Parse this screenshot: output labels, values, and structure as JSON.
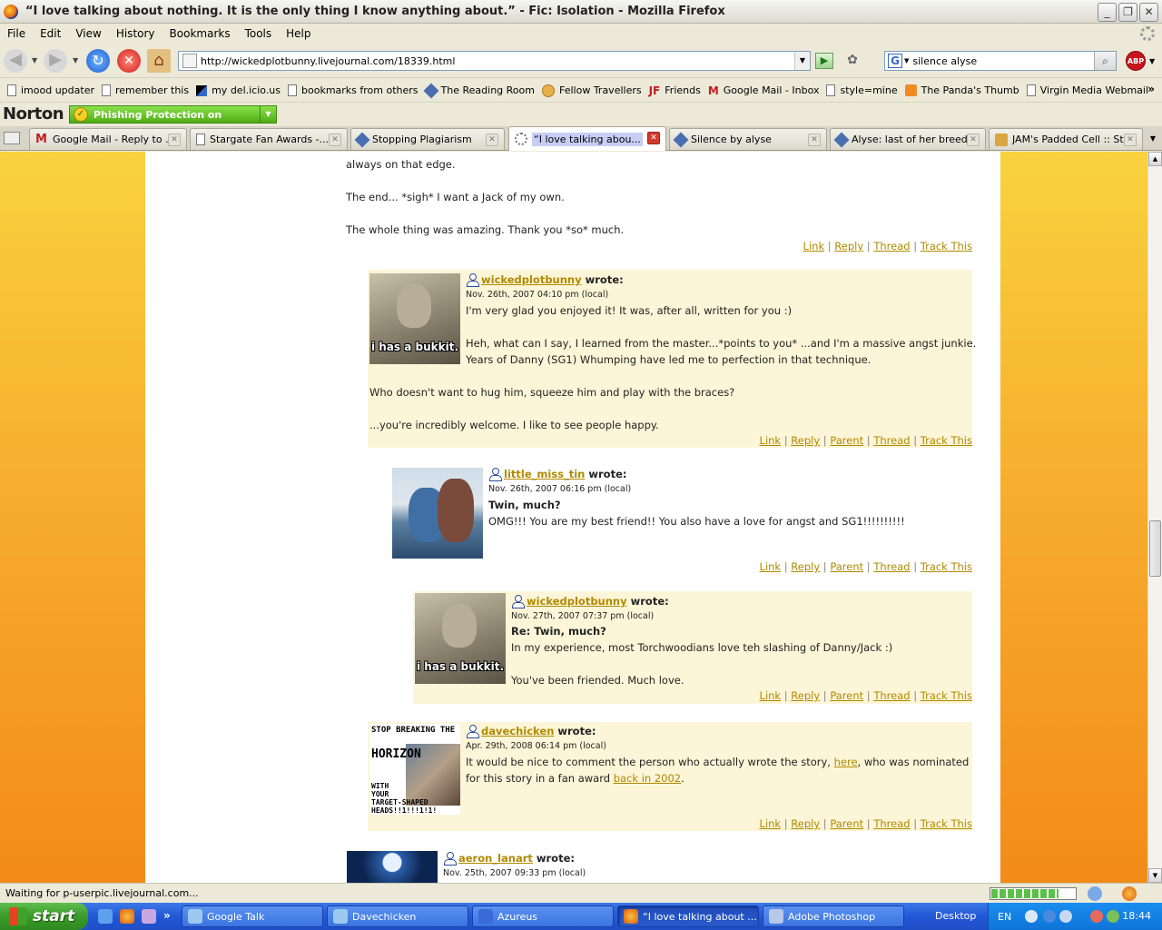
{
  "window": {
    "title": "“I love talking about nothing. It is the only thing I know anything about.” - Fic: Isolation - Mozilla Firefox",
    "controls": {
      "minimize": "_",
      "maximize": "❐",
      "close": "✕"
    }
  },
  "menu": [
    "File",
    "Edit",
    "View",
    "History",
    "Bookmarks",
    "Tools",
    "Help"
  ],
  "nav": {
    "url": "http://wickedplotbunny.livejournal.com/18339.html",
    "search_value": "silence alyse",
    "search_engine_icon": "G",
    "adblock_label": "ABP"
  },
  "bookmarks": [
    {
      "label": "imood updater",
      "icon": "page-icon"
    },
    {
      "label": "remember this",
      "icon": "page-icon"
    },
    {
      "label": "my del.icio.us",
      "icon": "delicious-icon"
    },
    {
      "label": "bookmarks from others",
      "icon": "page-icon"
    },
    {
      "label": "The Reading Room",
      "icon": "pen-icon"
    },
    {
      "label": "Fellow Travellers",
      "icon": "face-icon"
    },
    {
      "label": "Friends",
      "icon": "jf-icon"
    },
    {
      "label": "Google Mail - Inbox",
      "icon": "gmail-icon"
    },
    {
      "label": "style=mine",
      "icon": "page-icon"
    },
    {
      "label": "The Panda's Thumb",
      "icon": "rss-icon"
    },
    {
      "label": "Virgin Media Webmail",
      "icon": "page-icon"
    }
  ],
  "norton": {
    "logo": "Norton",
    "status": "Phishing Protection on"
  },
  "tabs": [
    {
      "label": "Google Mail - Reply to ...",
      "icon": "gmail-icon"
    },
    {
      "label": "Stargate Fan Awards -...",
      "icon": "page-icon"
    },
    {
      "label": "Stopping Plagiarism",
      "icon": "pen-icon"
    },
    {
      "label": "“I love talking abou...",
      "icon": "loading-icon",
      "active": true
    },
    {
      "label": "Silence by alyse",
      "icon": "pen-icon"
    },
    {
      "label": "Alyse: last of her breed",
      "icon": "pen-icon"
    },
    {
      "label": "JAM's Padded Cell :: St...",
      "icon": "cell-icon"
    }
  ],
  "page": {
    "top_lines": [
      "always on that edge.",
      "The end... *sigh* I want a Jack of my own.",
      "The whole thing was amazing. Thank you *so* much."
    ],
    "top_actions": [
      "Link",
      "Reply",
      "Thread",
      "Track This"
    ],
    "comments": [
      {
        "user": "wickedplotbunny",
        "wrote": "wrote:",
        "date": "Nov. 26th, 2007 04:10 pm (local)",
        "userpic_caption": "i has a bukkit.",
        "lines": [
          "I'm very glad you enjoyed it! It was, after all, written for you :)",
          "Heh, what can I say, I learned from the master...*points to you* ...and I'm a massive angst junkie.",
          "Years of Danny (SG1) Whumping have led me to perfection in that technique.",
          "Who doesn't want to hug him, squeeze him and play with the braces?",
          "...you're incredibly welcome. I like to see people happy."
        ],
        "actions": [
          "Link",
          "Reply",
          "Parent",
          "Thread",
          "Track This"
        ]
      },
      {
        "user": "little_miss_tin",
        "wrote": "wrote:",
        "date": "Nov. 26th, 2007 06:16 pm (local)",
        "subject": "Twin, much?",
        "lines": [
          "OMG!!! You are my best friend!! You also have a love for angst and SG1!!!!!!!!!!"
        ],
        "actions": [
          "Link",
          "Reply",
          "Parent",
          "Thread",
          "Track This"
        ]
      },
      {
        "user": "wickedplotbunny",
        "wrote": "wrote:",
        "date": "Nov. 27th, 2007 07:37 pm (local)",
        "userpic_caption": "i has a bukkit.",
        "subject": "Re: Twin, much?",
        "lines": [
          "In my experience, most Torchwoodians love teh slashing of Danny/Jack :)",
          "You've been friended. Much love."
        ],
        "actions": [
          "Link",
          "Reply",
          "Parent",
          "Thread",
          "Track This"
        ]
      },
      {
        "user": "davechicken",
        "wrote": "wrote:",
        "date": "Apr. 29th, 2008 06:14 pm (local)",
        "userpic_text": {
          "top": "STOP BREAKING THE",
          "mid": "HORIZON",
          "bottom": "WITH\nYOUR\nTARGET-SHAPED\nHEADS!!1!!!1!1!"
        },
        "line1_before": "It would be nice to comment the person who actually wrote the story, ",
        "line1_link": "here",
        "line1_after": ", who was nominated",
        "line2_before": "for this story in a fan award ",
        "line2_link": "back in 2002",
        "line2_after": ".",
        "actions": [
          "Link",
          "Reply",
          "Parent",
          "Thread",
          "Track This"
        ]
      },
      {
        "user": "aeron_lanart",
        "wrote": "wrote:",
        "date": "Nov. 25th, 2007 09:33 pm (local)"
      }
    ]
  },
  "status": {
    "text": "Waiting for p-userpic.livejournal.com...",
    "progress": 0.8
  },
  "taskbar": {
    "start": "start",
    "buttons": [
      {
        "label": "Google Talk"
      },
      {
        "label": "Davechicken"
      },
      {
        "label": "Azureus"
      },
      {
        "label": "“I love talking about ...",
        "active": true
      },
      {
        "label": "Adobe Photoshop"
      }
    ],
    "desktop": "Desktop",
    "lang": "EN",
    "clock": "18:44"
  }
}
